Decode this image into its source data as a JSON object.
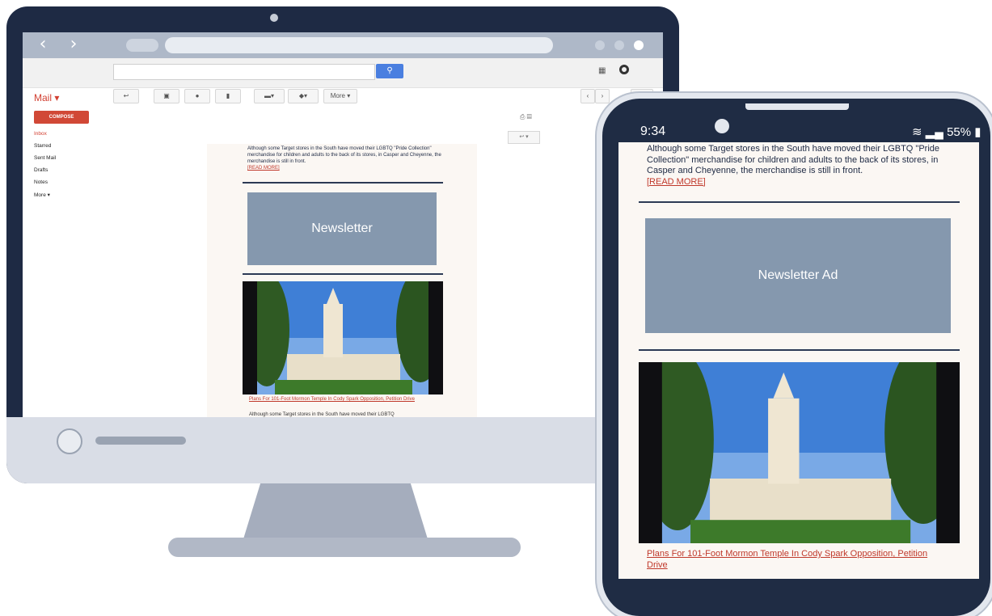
{
  "colors": {
    "bezel": "#1e2a44",
    "chin": "#d9dde6",
    "accent_red": "#d14836",
    "link_red": "#c0392b",
    "ad_block": "#8598ae",
    "email_bg": "#fbf7f3"
  },
  "gmail": {
    "mail_label": "Mail ▾",
    "compose_label": "COMPOSE",
    "folders": [
      "Inbox",
      "Starred",
      "Sent Mail",
      "Drafts",
      "Notes",
      "More ▾"
    ],
    "toolbar": {
      "reply_icon": "reply-icon",
      "archive_icon": "archive-icon",
      "spam_icon": "report-spam-icon",
      "delete_icon": "trash-icon",
      "move_icon": "folder-icon",
      "labels_icon": "tag-icon",
      "more_label": "More ▾"
    },
    "search_icon": "search-icon"
  },
  "email": {
    "article_text": "Although some Target stores in the South have moved their LGBTQ \"Pride Collection\" merchandise for children and adults to the back of its stores, in Casper and Cheyenne, the merchandise is still in front.",
    "read_more": "[READ MORE]",
    "monitor_ad_label": "Newsletter",
    "phone_ad_label": "Newsletter Ad",
    "headline": "Plans For 101-Foot Mormon Temple In Cody Spark Opposition, Petition Drive",
    "teaser": "Although some Target stores in the South have moved their LGBTQ"
  },
  "phone": {
    "time": "9:34",
    "battery": "55%"
  }
}
